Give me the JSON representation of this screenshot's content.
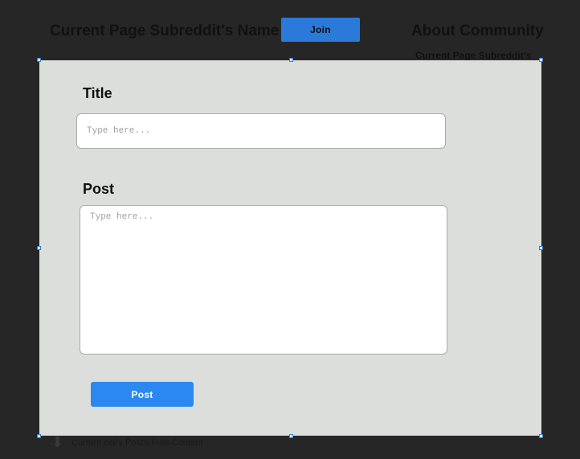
{
  "header": {
    "page_title": "Current Page Subreddit's Name",
    "join_label": "Join"
  },
  "sidebar": {
    "about_title": "About Community",
    "about_sub": "Current Page Subreddit's"
  },
  "modal": {
    "title_label": "Title",
    "title_placeholder": "Type here...",
    "post_label": "Post",
    "post_placeholder": "Type here...",
    "submit_label": "Post"
  },
  "background_post": {
    "content_text": "Current cell's Post's Post Content"
  }
}
